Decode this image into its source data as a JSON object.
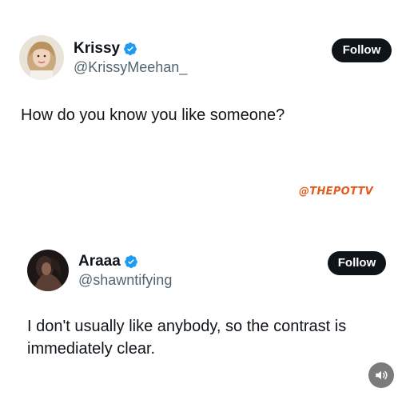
{
  "tweets": [
    {
      "display_name": "Krissy",
      "handle": "@KrissyMeehan_",
      "follow_label": "Follow",
      "text": "How do you know you like someone?",
      "verified": true,
      "avatar_icon": "avatar-photo"
    },
    {
      "display_name": "Araaa",
      "handle": "@shawntifying",
      "follow_label": "Follow",
      "text": "I don't usually like anybody, so the contrast is immediately clear.",
      "verified": true,
      "avatar_icon": "avatar-photo"
    }
  ],
  "watermark": "@THEPOTTV",
  "sound_button_icon": "speaker-icon",
  "colors": {
    "verified_blue": "#1d9bf0",
    "follow_bg": "#0f1419",
    "handle_gray": "#536471",
    "watermark_orange": "#e4591d"
  }
}
